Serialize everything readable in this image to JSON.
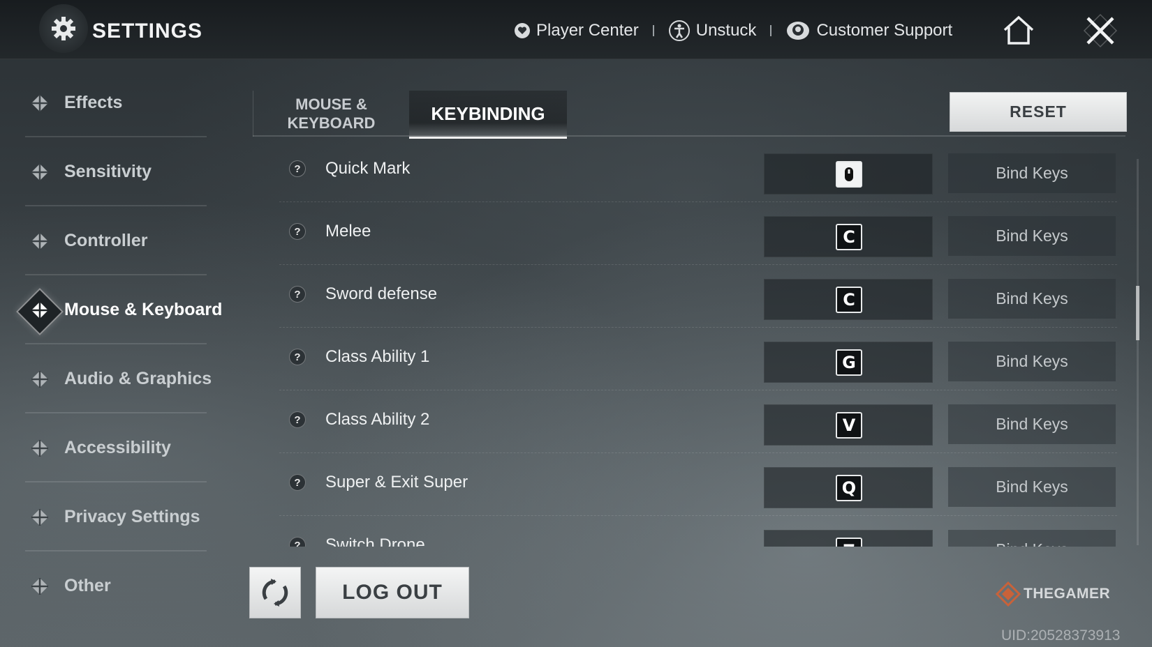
{
  "header": {
    "title": "SETTINGS",
    "nav": [
      {
        "label": "Player Center",
        "icon": "shield-heart-icon"
      },
      {
        "label": "Unstuck",
        "icon": "person-icon"
      },
      {
        "label": "Customer Support",
        "icon": "headset-icon"
      }
    ],
    "icons": [
      "home-icon",
      "close-icon"
    ]
  },
  "sidebar": {
    "items": [
      {
        "label": "Effects",
        "active": false
      },
      {
        "label": "Sensitivity",
        "active": false
      },
      {
        "label": "Controller",
        "active": false
      },
      {
        "label": "Mouse & Keyboard",
        "active": true
      },
      {
        "label": "Audio & Graphics",
        "active": false
      },
      {
        "label": "Accessibility",
        "active": false
      },
      {
        "label": "Privacy Settings",
        "active": false
      },
      {
        "label": "Other",
        "active": false
      }
    ]
  },
  "tabs": [
    {
      "label": "MOUSE & KEYBOARD",
      "active": false
    },
    {
      "label": "KEYBINDING",
      "active": true
    }
  ],
  "reset_label": "RESET",
  "bindings": [
    {
      "action": "Quick Mark",
      "key": "mouse-middle-icon",
      "bind_label": "Bind Keys"
    },
    {
      "action": "Melee",
      "key": "C",
      "bind_label": "Bind Keys"
    },
    {
      "action": "Sword defense",
      "key": "C",
      "bind_label": "Bind Keys"
    },
    {
      "action": "Class Ability 1",
      "key": "G",
      "bind_label": "Bind Keys"
    },
    {
      "action": "Class Ability 2",
      "key": "V",
      "bind_label": "Bind Keys"
    },
    {
      "action": "Super & Exit Super",
      "key": "Q",
      "bind_label": "Bind Keys"
    },
    {
      "action": "Switch Drone",
      "key": "Z",
      "bind_label": "Bind Keys"
    }
  ],
  "footer": {
    "logout_label": "LOG OUT",
    "brand": "THEGAMER",
    "uid": "UID:20528373913"
  },
  "colors": {
    "background": "#3a4145",
    "button_light": "#e6e8e9",
    "text": "#e6e8ea"
  }
}
